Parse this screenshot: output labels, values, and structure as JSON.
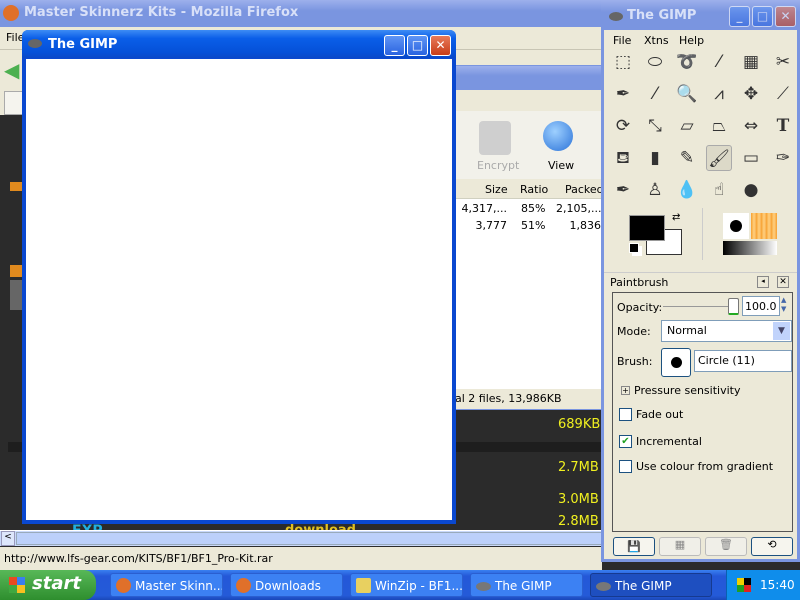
{
  "firefox": {
    "title": "Master Skinnerz Kits - Mozilla Firefox",
    "menu_file": "File",
    "status_url": "http://www.lfs-gear.com/KITS/BF1/BF1_Pro-Kit.rar"
  },
  "website": {
    "sizes": [
      "689KB",
      "2.7MB",
      "3.0MB",
      "2.8MB"
    ],
    "exp_label": "EXP",
    "download_label": "download"
  },
  "winzip": {
    "toolbar": {
      "encrypt": "Encrypt",
      "view": "View"
    },
    "columns": [
      "Size",
      "Ratio",
      "Packed"
    ],
    "rows": [
      [
        "4,317,...",
        "85%",
        "2,105,..."
      ],
      [
        "3,777",
        "51%",
        "1,836"
      ]
    ],
    "status": "al 2 files, 13,986KB"
  },
  "gimp_window": {
    "title": "The GIMP"
  },
  "toolbox": {
    "title": "The GIMP",
    "menu": [
      "File",
      "Xtns",
      "Help"
    ],
    "tools": [
      "rect-select",
      "ellipse-select",
      "free-select",
      "fuzzy-select",
      "color-select",
      "scissors",
      "paths",
      "color-picker",
      "magnify",
      "measure",
      "move",
      "crop",
      "rotate",
      "scale",
      "shear",
      "perspective",
      "flip",
      "text",
      "bucket-fill",
      "blend",
      "pencil",
      "paintbrush",
      "eraser",
      "airbrush",
      "ink",
      "clone",
      "blur",
      "smudge",
      "dodge-burn"
    ],
    "active_tool": "paintbrush",
    "colors": {
      "foreground": "#000000",
      "background": "#ffffff"
    }
  },
  "tool_options": {
    "title": "Paintbrush",
    "opacity_label": "Opacity:",
    "opacity_value": "100.0",
    "opacity_fraction": 1.0,
    "mode_label": "Mode:",
    "mode_value": "Normal",
    "brush_label": "Brush:",
    "brush_value": "Circle (11)",
    "pressure_label": "Pressure sensitivity",
    "fade_label": "Fade out",
    "fade_checked": false,
    "incremental_label": "Incremental",
    "incremental_checked": true,
    "gradient_label": "Use colour from gradient",
    "gradient_checked": false
  },
  "taskbar": {
    "start": "start",
    "items": [
      "Master Skinn...",
      "Downloads",
      "WinZip - BF1...",
      "The GIMP",
      "The GIMP"
    ],
    "clock": "15:40"
  }
}
